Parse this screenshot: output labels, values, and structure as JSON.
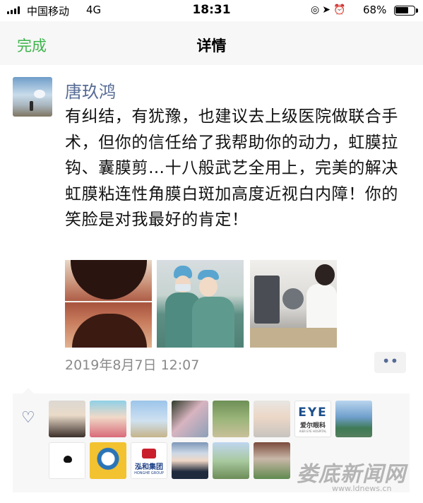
{
  "status_bar": {
    "carrier": "中国移动",
    "network": "4G",
    "time": "18:31",
    "battery_percent": "68%",
    "battery_level": 0.68,
    "icons": [
      "signal-bars",
      "rotation-lock",
      "location-arrow",
      "alarm-clock",
      "battery"
    ]
  },
  "nav": {
    "done_label": "完成",
    "title": "详情",
    "accent_color": "#3db44b"
  },
  "post": {
    "username": "唐玖鸿",
    "text": "有纠结，有犹豫，也建议去上级医院做联合手术，但你的信任给了我帮助你的动力，虹膜拉钩、囊膜剪…十八般武艺全用上，完美的解决虹膜粘连性角膜白斑加高度近视白内障！你的笑脸是对我最好的肯定！",
    "timestamp": "2019年8月7日 12:07",
    "more_label": "••",
    "username_color": "#566b95"
  },
  "likes": {
    "heart_icon": "♡",
    "avatar_row1_logo_text": "EYE",
    "avatar_row1_logo_cn": "爱尔眼科",
    "avatar_row1_logo_en": "AIER EYE HOSPITAL",
    "avatar_row2_logo_text": "泓和集团",
    "avatar_row2_logo_en": "HONGHE GROUP"
  },
  "watermark": {
    "text": "娄底新闻网",
    "url": "www.ldnews.cn"
  }
}
